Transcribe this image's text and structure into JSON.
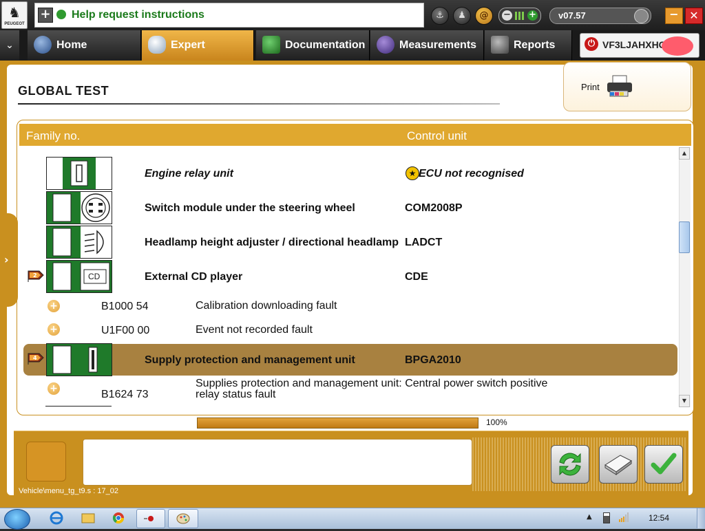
{
  "topbar": {
    "logo_brand": "PEUGEOT",
    "help_text": "Help request instructions",
    "version": "v07.57"
  },
  "tabs": [
    {
      "label": "Home",
      "icon": "home-icon"
    },
    {
      "label": "Expert",
      "icon": "magnifier-icon"
    },
    {
      "label": "Documentation",
      "icon": "book-icon"
    },
    {
      "label": "Measurements",
      "icon": "waveform-icon"
    },
    {
      "label": "Reports",
      "icon": "report-icon"
    }
  ],
  "vehicle": {
    "vin_visible": "VF3LJAHXHGS"
  },
  "page": {
    "title": "GLOBAL TEST",
    "print_label": "Print"
  },
  "table": {
    "headers": {
      "family": "Family no.",
      "unit": "Control unit"
    },
    "rows": [
      {
        "name": "Engine relay unit",
        "unit": "ECU not recognised"
      },
      {
        "name": "Switch module under the steering wheel",
        "unit": "COM2008P"
      },
      {
        "name": "Headlamp height adjuster / directional headlamp",
        "unit": "LADCT"
      },
      {
        "name": "External CD player",
        "unit": "CDE",
        "flag": "2"
      },
      {
        "name": "Supply protection and management unit",
        "unit": "BPGA2010",
        "flag": "4"
      }
    ],
    "faults": [
      {
        "code": "B1000 54",
        "desc": "Calibration downloading fault"
      },
      {
        "code": "U1F00 00",
        "desc": "Event not recorded fault"
      },
      {
        "code": "B1624 73",
        "desc": "Supplies protection and management unit: Central power switch positive relay status fault"
      }
    ],
    "cd_label": "CD"
  },
  "progress": {
    "value": 100,
    "label": "100%"
  },
  "footer": {
    "path": "Vehicle\\menu_tg_t9.s : 17_02"
  },
  "taskbar": {
    "clock": "12:54"
  },
  "colors": {
    "accent": "#c9901f",
    "header": "#e0a82f",
    "selected_row": "#a88140",
    "green": "#1f7a2a"
  }
}
